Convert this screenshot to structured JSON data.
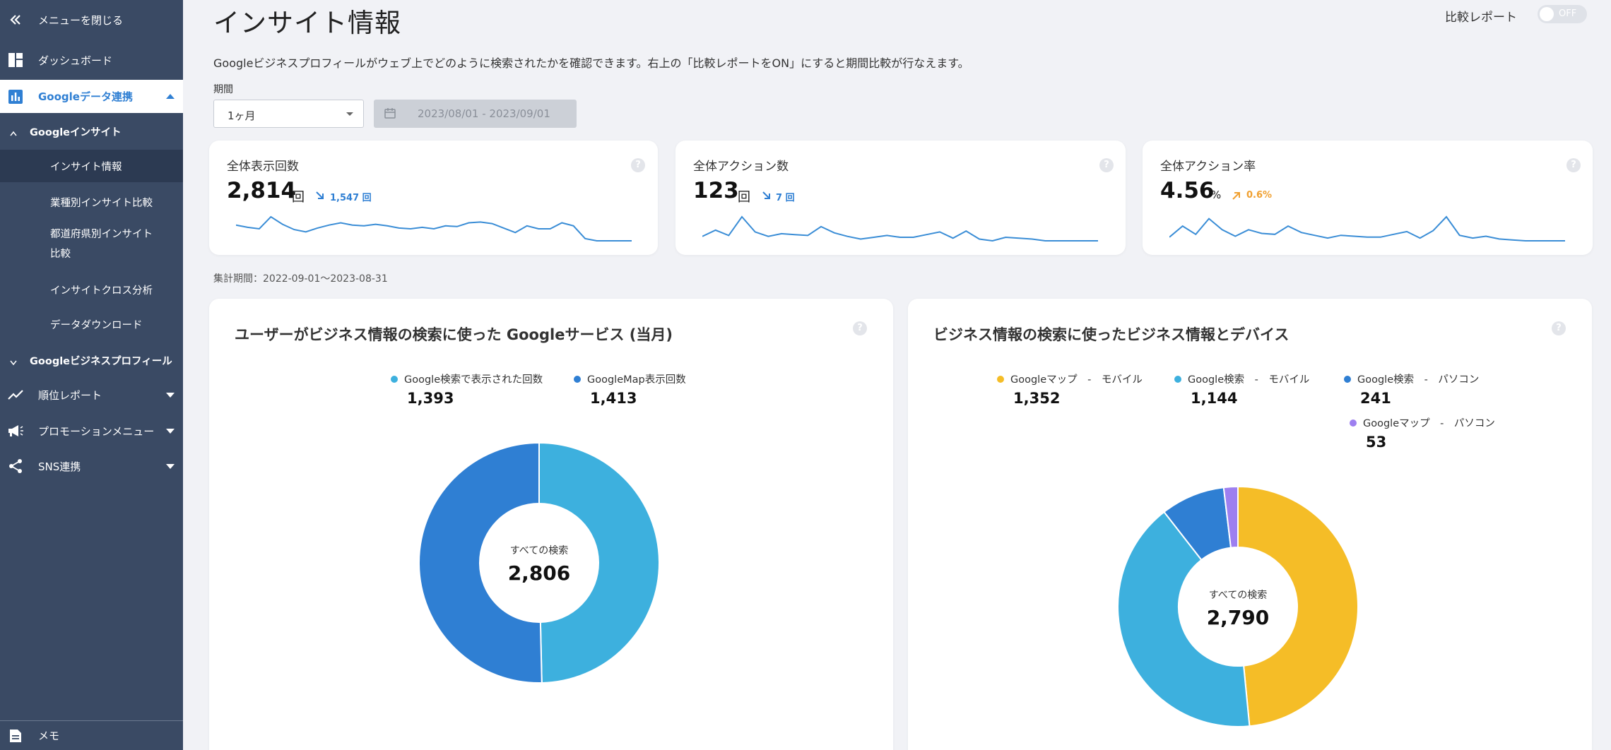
{
  "sidebar": {
    "close_menu": "メニューを閉じる",
    "dashboard": "ダッシュボード",
    "google_data": "Googleデータ連携",
    "google_insight": "Googleインサイト",
    "insight_info": "インサイト情報",
    "industry_compare": "業種別インサイト比較",
    "pref_compare_1": "都道府県別インサイト",
    "pref_compare_2": "比較",
    "cross_analysis": "インサイトクロス分析",
    "data_download": "データダウンロード",
    "gbp": "Googleビジネスプロフィール",
    "rank_report": "順位レポート",
    "promotion": "プロモーションメニュー",
    "sns": "SNS連携",
    "memo": "メモ"
  },
  "header": {
    "title": "インサイト情報",
    "compare_label": "比較レポート",
    "toggle_state": "OFF"
  },
  "description": "Googleビジネスプロフィールがウェブ上でどのように検索されたかを確認できます。右上の「比較レポートをON」にすると期間比較が行なえます。",
  "filters": {
    "period_label": "期間",
    "period_value": "1ヶ月",
    "date_range": "2023/08/01 - 2023/09/01"
  },
  "kpis": [
    {
      "title": "全体表示回数",
      "value": "2,814",
      "unit": "回",
      "delta": "1,547 回",
      "delta_dir": "down",
      "spark": [
        21,
        18,
        16,
        32,
        22,
        15,
        12,
        17,
        21,
        24,
        21,
        20,
        22,
        20,
        17,
        16,
        18,
        16,
        20,
        19,
        24,
        25,
        23,
        17,
        11,
        20,
        16,
        16,
        24,
        20,
        3,
        0,
        0,
        0,
        0
      ]
    },
    {
      "title": "全体アクション数",
      "value": "123",
      "unit": "回",
      "delta": "7 回",
      "delta_dir": "down",
      "spark": [
        5,
        12,
        6,
        27,
        10,
        5,
        8,
        7,
        6,
        16,
        9,
        5,
        2,
        4,
        6,
        4,
        4,
        7,
        10,
        3,
        11,
        2,
        0,
        4,
        3,
        2,
        0,
        0,
        0,
        0,
        0
      ]
    },
    {
      "title": "全体アクション率",
      "value": "4.56",
      "unit": "%",
      "delta": "0.6%",
      "delta_dir": "up",
      "spark": [
        4,
        16,
        7,
        24,
        12,
        5,
        12,
        8,
        7,
        16,
        9,
        6,
        3,
        6,
        5,
        4,
        4,
        7,
        10,
        3,
        11,
        26,
        6,
        3,
        5,
        2,
        1,
        0,
        0,
        0,
        0
      ]
    }
  ],
  "period_note": "集計期間：2022-09-01～2023-08-31",
  "chart_data": [
    {
      "type": "pie",
      "title": "ユーザーがビジネス情報の検索に使った Googleサービス (当月)",
      "center_label": "すべての検索",
      "center_value": "2,806",
      "series": [
        {
          "name": "Google検索で表示された回数",
          "value": 1393,
          "label": "1,393",
          "color": "#3db0de"
        },
        {
          "name": "GoogleMap表示回数",
          "value": 1413,
          "label": "1,413",
          "color": "#2f7fd3"
        }
      ]
    },
    {
      "type": "pie",
      "title": "ビジネス情報の検索に使ったビジネス情報とデバイス",
      "center_label": "すべての検索",
      "center_value": "2,790",
      "series": [
        {
          "name": "Googleマップ　-　モバイル",
          "value": 1352,
          "label": "1,352",
          "color": "#f5bd27"
        },
        {
          "name": "Google検索　-　モバイル",
          "value": 1144,
          "label": "1,144",
          "color": "#3db0de"
        },
        {
          "name": "Google検索　-　パソコン",
          "value": 241,
          "label": "241",
          "color": "#2f7fd3"
        },
        {
          "name": "Googleマップ　-　パソコン",
          "value": 53,
          "label": "53",
          "color": "#9d7ff0"
        }
      ]
    }
  ],
  "colors": {
    "accent": "#2f7fd3",
    "sidebar": "#3a4a64",
    "spark": "#3a8dd6",
    "delta_down": "#2f7fd3",
    "delta_up": "#f0a030"
  }
}
